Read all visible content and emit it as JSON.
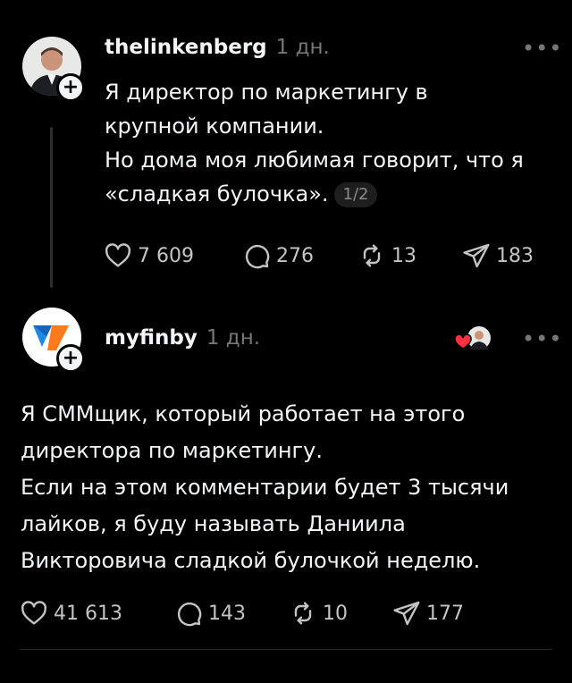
{
  "post": {
    "username": "thelinkenberg",
    "time": "1 дн.",
    "lines": [
      "Я директор по маркетингу в",
      "крупной компании.",
      "Но дома моя любимая говорит, что я",
      "«сладкая булочка»."
    ],
    "page_badge": "1/2",
    "likes": "7 609",
    "comments": "276",
    "reposts": "13",
    "shares": "183"
  },
  "reply": {
    "username": "myfinby",
    "time": "1 дн.",
    "lines": [
      "Я СММщик, который работает на этого",
      "директора по маркетингу.",
      "Если на этом комментарии будет 3 тысячи",
      "лайков, я буду называть Даниила",
      "Викторовича сладкой булочкой неделю."
    ],
    "likes": "41 613",
    "comments": "143",
    "reposts": "10",
    "shares": "177"
  },
  "icons": {
    "more": "more-horizontal-icon",
    "like": "heart-icon",
    "comment": "comment-bubble-icon",
    "repost": "repost-icon",
    "share": "send-icon",
    "follow": "plus-icon",
    "liked_by_author": "heart-filled-icon"
  },
  "colors": {
    "background": "#000000",
    "text": "#f3f5f7",
    "muted": "#777777",
    "like_red": "#ff3040",
    "brand_blue": "#1565c0",
    "brand_orange": "#ff7a1a"
  }
}
